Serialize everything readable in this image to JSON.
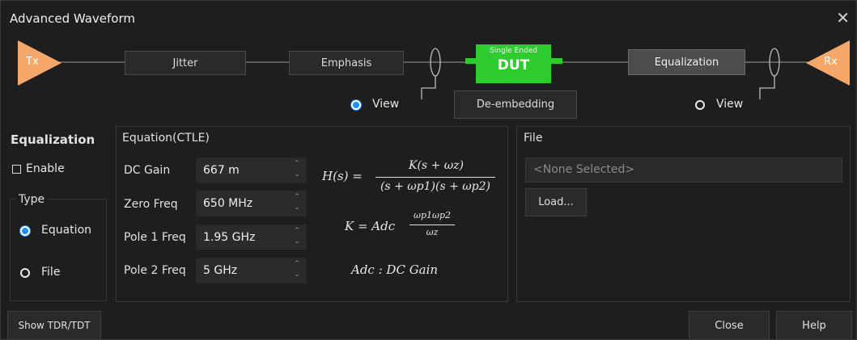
{
  "window": {
    "title": "Advanced Waveform",
    "close_glyph": "✕"
  },
  "chain": {
    "tx": "Tx",
    "rx": "Rx",
    "jitter": "Jitter",
    "emphasis": "Emphasis",
    "dut_top": "Single Ended",
    "dut": "DUT",
    "equalization": "Equalization",
    "deembed": "De-embedding",
    "view_left": "View",
    "view_right": "View",
    "view_left_selected": true,
    "view_right_selected": false
  },
  "equalization": {
    "heading": "Equalization",
    "enable_label": "Enable",
    "enable_checked": false,
    "type_heading": "Type",
    "type_options": [
      {
        "label": "Equation",
        "selected": true
      },
      {
        "label": "File",
        "selected": false
      }
    ]
  },
  "equation": {
    "heading": "Equation(CTLE)",
    "params": [
      {
        "label": "DC Gain",
        "value": "667 m"
      },
      {
        "label": "Zero Freq",
        "value": "650 MHz"
      },
      {
        "label": "Pole 1 Freq",
        "value": "1.95 GHz"
      },
      {
        "label": "Pole 2 Freq",
        "value": "5 GHz"
      }
    ],
    "formula_h_lhs": "H(s) =",
    "formula_h_num": "K(s + ωz)",
    "formula_h_den": "(s + ωp1)(s + ωp2)",
    "formula_k_lhs": "K = Adc",
    "formula_k_num": "ωp1ωp2",
    "formula_k_den": "ωz",
    "formula_adc": "Adc : DC Gain"
  },
  "file": {
    "heading": "File",
    "placeholder": "<None Selected>",
    "load_label": "Load..."
  },
  "footer": {
    "tdr": "Show TDR/TDT",
    "close": "Close",
    "help": "Help"
  },
  "colors": {
    "tx_rx": "#f5a86a",
    "dut": "#2ecc2e",
    "accent": "#1f8cff"
  }
}
